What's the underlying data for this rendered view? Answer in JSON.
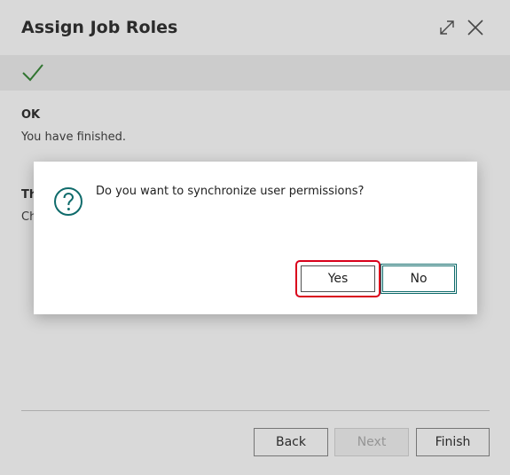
{
  "wizard": {
    "title": "Assign Job Roles",
    "ok_heading": "OK",
    "finished_text": "You have finished.",
    "hidden_heading_fragment": "Th",
    "hidden_line_fragment": "Ch",
    "buttons": {
      "back": "Back",
      "next": "Next",
      "finish": "Finish"
    },
    "icons": {
      "expand": "expand-icon",
      "close": "close-icon",
      "check": "checkmark-icon"
    }
  },
  "dialog": {
    "question": "Do you want to synchronize user permissions?",
    "yes_label": "Yes",
    "no_label": "No",
    "icon": "question-icon"
  },
  "colors": {
    "accent": "#0f6b6b",
    "success": "#3a8a3a",
    "highlight": "#d9001b"
  }
}
